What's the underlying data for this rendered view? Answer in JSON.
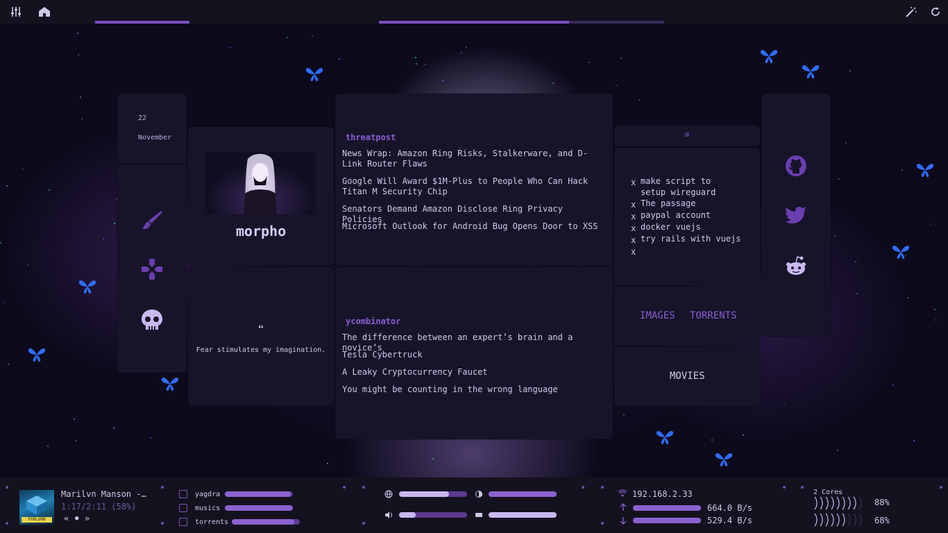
{
  "topbar": {
    "left_icons": [
      "sliders-icon",
      "home-icon"
    ],
    "right_icons": [
      "magic-wand-icon",
      "refresh-icon"
    ],
    "accent": "#7b4fc0"
  },
  "date": {
    "day": "22",
    "month": "November"
  },
  "side_icons": [
    "paintbrush-icon",
    "gamepad-icon",
    "skull-icon"
  ],
  "profile": {
    "name": "morpho"
  },
  "quote": {
    "mark": "❝",
    "text": "Fear stimulates my imagination."
  },
  "feeds": [
    {
      "title": "threatpost",
      "items": [
        "News Wrap: Amazon Ring Risks, Stalkerware, and D-Link Router Flaws",
        "Google Will Award $1M-Plus to People Who Can Hack Titan M Security Chip",
        "Senators Demand Amazon Disclose Ring Privacy Policies",
        "Microsoft Outlook for Android Bug Opens Door to XSS"
      ]
    },
    {
      "title": "ycombinator",
      "items": [
        "The difference between an expert’s brain and a novice’s",
        "Tesla Cybertruck",
        "A Leaky Cryptocurrency Faucet",
        "You might be counting in the wrong language"
      ]
    }
  ],
  "todo": {
    "add_symbol": "⊞",
    "mark": "x",
    "items": [
      "make script to setup wireguard",
      "The passage",
      "paypal account",
      "docker vuejs",
      "try rails with vuejs",
      ""
    ]
  },
  "links": {
    "images": "IMAGES",
    "torrents": "TORRENTS",
    "movies": "MOVIES"
  },
  "social_icons": [
    "github-icon",
    "twitter-icon",
    "reddit-icon"
  ],
  "music": {
    "album_tag": "FORLORN SYNAPSE 2",
    "title": "Marilvn Manson -…",
    "time": "1:17/2:11 (58%)",
    "controls": [
      "«",
      "●",
      "»"
    ],
    "progress": 0.58
  },
  "disks": [
    {
      "label": "yagdra",
      "usage": 0.97
    },
    {
      "label": "musics",
      "usage": 1.0
    },
    {
      "label": "torrents",
      "usage": 0.92
    }
  ],
  "system_controls": [
    {
      "name": "network",
      "icon": "globe-icon",
      "level": 0.73
    },
    {
      "name": "brightness",
      "icon": "brightness-icon",
      "level": 1.0
    },
    {
      "name": "volume",
      "icon": "volume-icon",
      "level": 0.24
    },
    {
      "name": "battery",
      "icon": "battery-icon",
      "level": 1.0
    }
  ],
  "network": {
    "ip": "192.168.2.33",
    "upload": "664.0 B/s",
    "download": "529.4 B/s"
  },
  "cpu": {
    "label": "2 Cores",
    "cores": [
      {
        "percent": "88%"
      },
      {
        "percent": "68%"
      }
    ]
  },
  "colors": {
    "panel": "#17142a",
    "accent": "#8a5dd1",
    "butterfly": "#2f6dff"
  }
}
